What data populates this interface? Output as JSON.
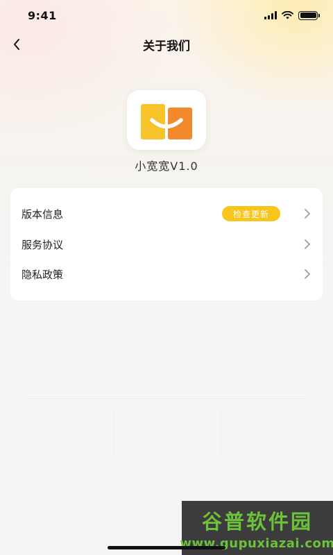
{
  "status_bar": {
    "time": "9:41"
  },
  "nav": {
    "title": "关于我们",
    "back_icon": "chevron-left-icon"
  },
  "app": {
    "name": "小宽宽V1.0",
    "icon": "app-logo-icon"
  },
  "settings": {
    "items": [
      {
        "label": "版本信息",
        "badge": "检查更新",
        "icon": "chevron-right-icon"
      },
      {
        "label": "服务协议",
        "icon": "chevron-right-icon"
      },
      {
        "label": "隐私政策",
        "icon": "chevron-right-icon"
      }
    ]
  },
  "watermark": {
    "title": "谷普软件园",
    "url": "www.gupuxiazai.com"
  },
  "colors": {
    "badge": "#f7c51c",
    "logo_yellow": "#f6c42a",
    "logo_orange": "#f08a2d",
    "watermark_green": "#6cc33b"
  }
}
